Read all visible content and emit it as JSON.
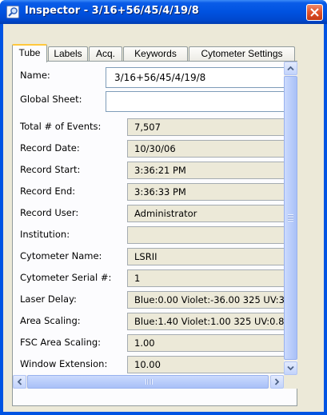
{
  "window": {
    "title": "Inspector - 3/16+56/45/4/19/8",
    "icon": "magnifier-icon",
    "close_icon": "close-icon"
  },
  "tabs": [
    {
      "label": "Tube",
      "active": true
    },
    {
      "label": "Labels",
      "active": false
    },
    {
      "label": "Acq.",
      "active": false
    },
    {
      "label": "Keywords",
      "active": false
    },
    {
      "label": "Cytometer Settings",
      "active": false
    }
  ],
  "form": {
    "name": {
      "label": "Name:",
      "value": "3/16+56/45/4/19/8"
    },
    "global_sheet": {
      "label": "Global Sheet:",
      "value": ""
    },
    "fields": [
      {
        "label": "Total # of Events:",
        "value": "7,507"
      },
      {
        "label": "Record Date:",
        "value": "10/30/06"
      },
      {
        "label": "Record Start:",
        "value": "3:36:21 PM"
      },
      {
        "label": "Record End:",
        "value": "3:36:33 PM"
      },
      {
        "label": "Record User:",
        "value": "Administrator"
      },
      {
        "label": "Institution:",
        "value": ""
      },
      {
        "label": "Cytometer Name:",
        "value": "LSRII"
      },
      {
        "label": "Cytometer Serial #:",
        "value": "1"
      },
      {
        "label": "Laser Delay:",
        "value": "Blue:0.00  Violet:-36.00  325 UV:3"
      },
      {
        "label": "Area Scaling:",
        "value": "Blue:1.40  Violet:1.00  325 UV:0.8"
      },
      {
        "label": "FSC Area Scaling:",
        "value": "1.00"
      },
      {
        "label": "Window Extension:",
        "value": "10.00"
      }
    ]
  },
  "colors": {
    "titlebar": "#0054e3",
    "window_bg": "#ece9d8",
    "readonly_field": "#ece9d8",
    "active_tab_highlight": "#ffc83c"
  }
}
